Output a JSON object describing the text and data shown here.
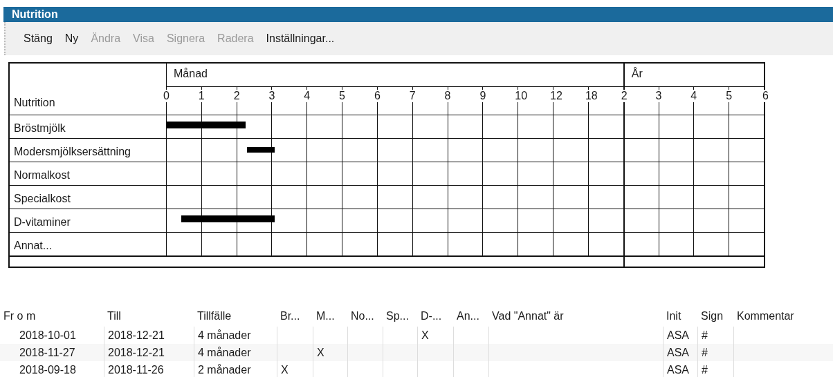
{
  "window": {
    "title": "Nutrition"
  },
  "toolbar": [
    {
      "label": "Stäng",
      "disabled": false
    },
    {
      "label": "Ny",
      "disabled": false
    },
    {
      "label": "Ändra",
      "disabled": true
    },
    {
      "label": "Visa",
      "disabled": true
    },
    {
      "label": "Signera",
      "disabled": true
    },
    {
      "label": "Radera",
      "disabled": true
    },
    {
      "label": "Inställningar...",
      "disabled": false
    }
  ],
  "timeline": {
    "groups": [
      {
        "label": "Månad",
        "ticks": [
          "0",
          "1",
          "2",
          "3",
          "4",
          "5",
          "6",
          "7",
          "8",
          "9",
          "10",
          "12",
          "18"
        ]
      },
      {
        "label": "År",
        "ticks": [
          "2",
          "3",
          "4",
          "5",
          "6"
        ]
      }
    ],
    "corner_label": "Nutrition",
    "rows": [
      {
        "label": "Bröstmjölk"
      },
      {
        "label": "Modersmjölksersättning"
      },
      {
        "label": "Normalkost"
      },
      {
        "label": "Specialkost"
      },
      {
        "label": "D-vitaminer"
      },
      {
        "label": "Annat..."
      }
    ]
  },
  "table": {
    "columns": [
      "Fr o m",
      "Till",
      "Tillfälle",
      "Br...",
      "M...",
      "No...",
      "Sp...",
      "D-...",
      "An...",
      "Vad \"Annat\" är",
      "Init",
      "Sign",
      "Kommentar"
    ],
    "rows": [
      [
        "2018-10-01",
        "2018-12-21",
        "4 månader",
        "",
        "",
        "",
        "",
        "X",
        "",
        "",
        "ASA",
        "#",
        ""
      ],
      [
        "2018-11-27",
        "2018-12-21",
        "4 månader",
        "",
        "X",
        "",
        "",
        "",
        "",
        "",
        "ASA",
        "#",
        ""
      ],
      [
        "2018-09-18",
        "2018-11-26",
        "2 månader",
        "X",
        "",
        "",
        "",
        "",
        "",
        "",
        "ASA",
        "#",
        ""
      ]
    ]
  }
}
